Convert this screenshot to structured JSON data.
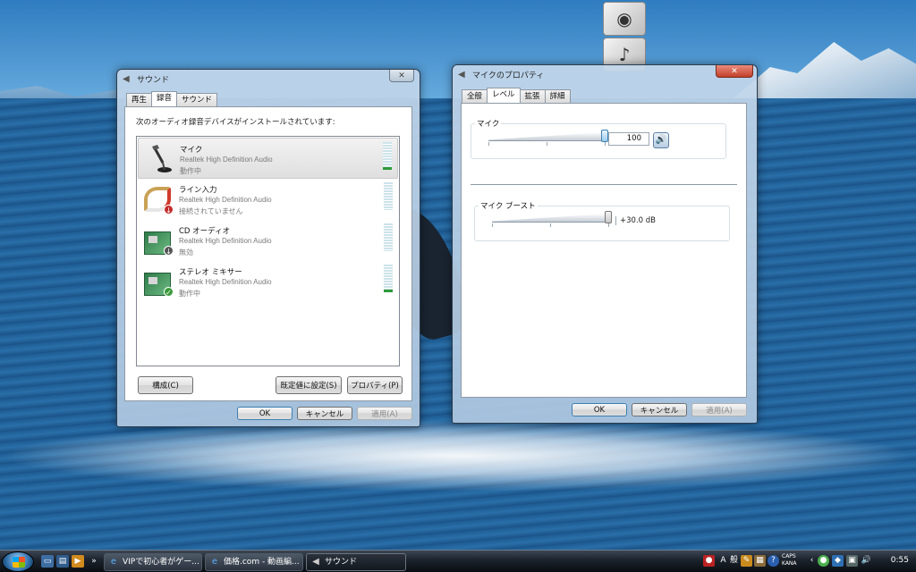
{
  "sound_window": {
    "title": "サウンド",
    "close_label": "✕",
    "tabs": [
      "再生",
      "録音",
      "サウンド"
    ],
    "instruction": "次のオーディオ録音デバイスがインストールされています:",
    "devices": [
      {
        "name": "マイク",
        "driver": "Realtek High Definition Audio",
        "status": "動作中",
        "level": 0.1
      },
      {
        "name": "ライン入力",
        "driver": "Realtek High Definition Audio",
        "status": "接続されていません",
        "level": 0
      },
      {
        "name": "CD オーディオ",
        "driver": "Realtek High Definition Audio",
        "status": "無効",
        "level": 0
      },
      {
        "name": "ステレオ ミキサー",
        "driver": "Realtek High Definition Audio",
        "status": "動作中",
        "level": 0.1
      }
    ],
    "configure_label": "構成(C)",
    "set_default_label": "既定値に設定(S)",
    "properties_label": "プロパティ(P)",
    "ok_label": "OK",
    "cancel_label": "キャンセル",
    "apply_label": "適用(A)"
  },
  "mic_window": {
    "title": "マイクのプロパティ",
    "close_label": "✕",
    "tabs": [
      "全般",
      "レベル",
      "拡張",
      "詳細"
    ],
    "mic_label": "マイク",
    "mic_value": "100",
    "mic_level": 1.0,
    "boost_label": "マイク ブースト",
    "boost_value": "+30.0 dB",
    "boost_level": 1.0,
    "ok_label": "OK",
    "cancel_label": "キャンセル",
    "apply_label": "適用(A)"
  },
  "taskbar": {
    "tasks": [
      {
        "label": "VIPで初心者がゲー..."
      },
      {
        "label": "価格.com - 動画編..."
      },
      {
        "label": "サウンド"
      }
    ],
    "ime_mode": "A",
    "ime_label": "般",
    "caps_label": "CAPS",
    "kana_label": "KANA",
    "chevron": "»",
    "clock": "0:55"
  },
  "colors": {
    "meter_green": "#2f9a3a",
    "titlebar_glass": "#c3d7eb",
    "close_red": "#c2402b"
  }
}
